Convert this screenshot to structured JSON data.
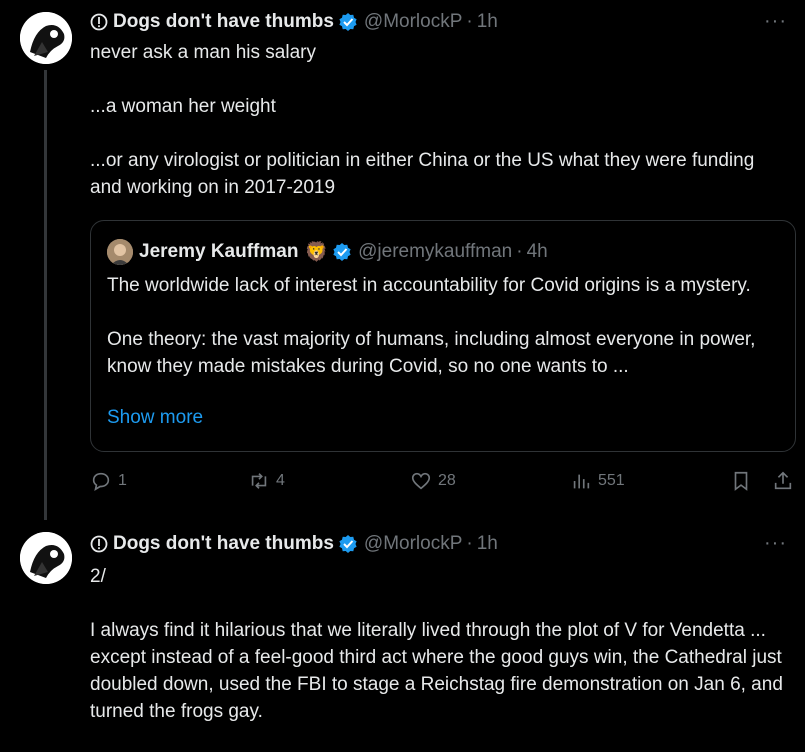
{
  "tweet1": {
    "name": "Dogs don't have thumbs",
    "handle": "@MorlockP",
    "time": "1h",
    "paragraphs": [
      "never ask a man his salary",
      "...a woman her weight",
      "...or any virologist or politician in either China or the US what they were funding and working on in 2017-2019"
    ],
    "quote": {
      "name": "Jeremy Kauffman",
      "emoji": "🦁",
      "handle": "@jeremykauffman",
      "time": "4h",
      "paragraphs": [
        "The worldwide lack of interest in accountability for Covid origins is a mystery.",
        "One theory: the vast majority of humans, including almost everyone in power, know they made mistakes during Covid, so no one wants to ..."
      ],
      "show_more": "Show more"
    },
    "actions": {
      "replies": "1",
      "reposts": "4",
      "likes": "28",
      "views": "551"
    }
  },
  "tweet2": {
    "name": "Dogs don't have thumbs",
    "handle": "@MorlockP",
    "time": "1h",
    "paragraphs": [
      "2/",
      "I always find it hilarious that we literally lived through the plot of V for Vendetta ... except instead of a feel-good third act where the good guys win, the Cathedral just doubled down, used the FBI to stage a Reichstag fire demonstration on Jan 6, and turned the frogs gay."
    ]
  },
  "ui": {
    "dot": "·",
    "more": "···",
    "accent": "#1d9bf0",
    "muted": "#71767b"
  }
}
